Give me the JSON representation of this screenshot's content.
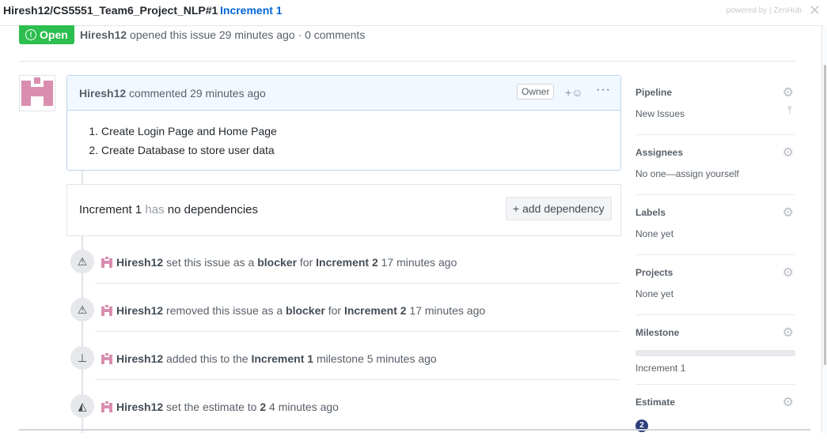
{
  "header": {
    "repo": "Hiresh12/CS5551_Team6_Project_NLP#1",
    "issue_title": "Increment 1",
    "powered_by": "powered by | ZenHub",
    "close_glyph": "✕"
  },
  "issue": {
    "state": "Open",
    "author": "Hiresh12",
    "meta_text": " opened this issue 29 minutes ago · 0 comments"
  },
  "comment": {
    "author": "Hiresh12",
    "action": " commented 29 minutes ago",
    "owner_badge": "Owner",
    "reaction_glyph": "+☺",
    "more_glyph": "···",
    "items": [
      "Create Login Page and Home Page",
      "Create Database to store user data"
    ]
  },
  "dependencies": {
    "issue": "Increment 1",
    "has": " has ",
    "none": "no dependencies",
    "button": "+ add dependency"
  },
  "events": [
    {
      "icon": "alert-icon",
      "glyph": "⚠",
      "user": "Hiresh12",
      "pre": " set this issue as a ",
      "b1": "blocker",
      "mid": " for ",
      "b2": "Increment 2",
      "post": " 17 minutes ago"
    },
    {
      "icon": "alert-icon",
      "glyph": "⚠",
      "user": "Hiresh12",
      "pre": " removed this issue as a ",
      "b1": "blocker",
      "mid": " for ",
      "b2": "Increment 2",
      "post": " 17 minutes ago"
    },
    {
      "icon": "milestone-icon",
      "glyph": "⊥",
      "user": "Hiresh12",
      "pre": " added this to the ",
      "b1": "Increment 1",
      "mid": " milestone 5 minutes ago",
      "b2": "",
      "post": ""
    },
    {
      "icon": "estimate-icon",
      "glyph": "◭",
      "user": "Hiresh12",
      "pre": " set the estimate to ",
      "b1": "2",
      "mid": " 4 minutes ago",
      "b2": "",
      "post": ""
    }
  ],
  "sidebar": {
    "pipeline": {
      "title": "Pipeline",
      "value": "New Issues"
    },
    "assignees": {
      "title": "Assignees",
      "value": "No one—assign yourself"
    },
    "labels": {
      "title": "Labels",
      "value": "None yet"
    },
    "projects": {
      "title": "Projects",
      "value": "None yet"
    },
    "milestone": {
      "title": "Milestone",
      "value": "Increment 1",
      "progress": 0
    },
    "estimate": {
      "title": "Estimate",
      "value": "2"
    },
    "gear_glyph": "⚙",
    "move_top_glyph": "⤒"
  },
  "colors": {
    "accent": "#0366d6",
    "open": "#2cbe4e",
    "avatar": "#d98eb0",
    "estimate": "#2d3f7c"
  }
}
